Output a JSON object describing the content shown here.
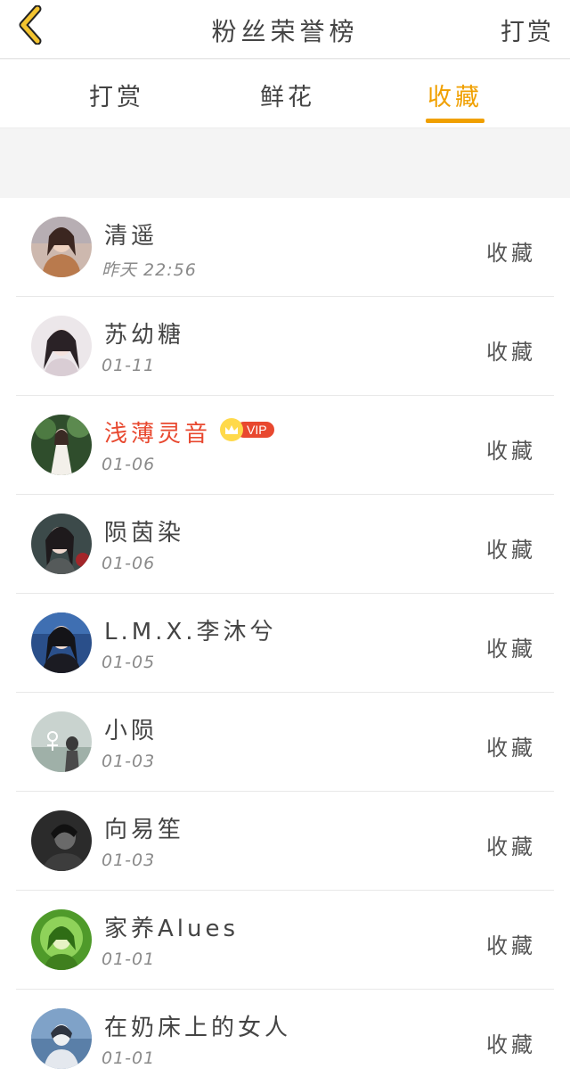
{
  "header": {
    "title": "粉丝荣誉榜",
    "action": "打赏"
  },
  "tabs": [
    {
      "label": "打赏"
    },
    {
      "label": "鲜花"
    },
    {
      "label": "收藏"
    }
  ],
  "colors": {
    "accent": "#f0a000",
    "vip": "#e8482f"
  },
  "rows": [
    {
      "name": "清遥",
      "time": "昨天 22:56",
      "action": "收藏"
    },
    {
      "name": "苏幼糖",
      "time": "01-11",
      "action": "收藏"
    },
    {
      "name": "浅薄灵音",
      "time": "01-06",
      "action": "收藏",
      "badge": "VIP"
    },
    {
      "name": "陨茵染",
      "time": "01-06",
      "action": "收藏"
    },
    {
      "name": "L.M.X.李沐兮",
      "time": "01-05",
      "action": "收藏"
    },
    {
      "name": "小陨",
      "time": "01-03",
      "action": "收藏"
    },
    {
      "name": "向易笙",
      "time": "01-03",
      "action": "收藏"
    },
    {
      "name": "家养Alues",
      "time": "01-01",
      "action": "收藏"
    },
    {
      "name": "在奶床上的女人",
      "time": "01-01",
      "action": "收藏"
    }
  ]
}
